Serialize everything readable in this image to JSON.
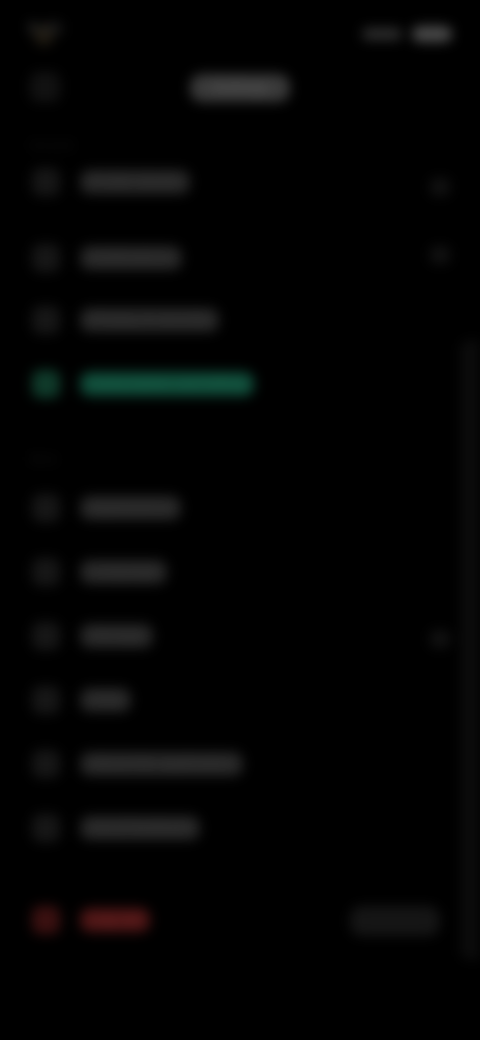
{
  "status_bar": {
    "time": "9:41"
  },
  "header": {
    "title": "Settings"
  },
  "sections": [
    {
      "label": "Account",
      "items": [
        {
          "name": "profile",
          "label": "Profile details",
          "icon": "user-icon"
        },
        {
          "name": "notifications",
          "label": "Notifications",
          "icon": "bell-icon"
        },
        {
          "name": "privacy",
          "label": "Privacy & security",
          "icon": "shield-icon"
        },
        {
          "name": "subscription",
          "label": "Subscription and billing",
          "icon": "card-icon",
          "active": true
        }
      ]
    },
    {
      "label": "More",
      "items": [
        {
          "name": "appearance",
          "label": "Appearance",
          "icon": "palette-icon"
        },
        {
          "name": "language",
          "label": "Language",
          "icon": "globe-icon"
        },
        {
          "name": "storage",
          "label": "Storage",
          "icon": "database-icon"
        },
        {
          "name": "help",
          "label": "Help",
          "icon": "help-icon"
        },
        {
          "name": "about",
          "label": "About this application",
          "icon": "info-icon"
        },
        {
          "name": "feedback",
          "label": "Send feedback",
          "icon": "message-icon"
        }
      ]
    }
  ],
  "logout": {
    "label": "Log out",
    "icon": "logout-icon"
  },
  "colors": {
    "accent": "#0f4a38",
    "danger": "#4a1414",
    "background": "#000000"
  }
}
